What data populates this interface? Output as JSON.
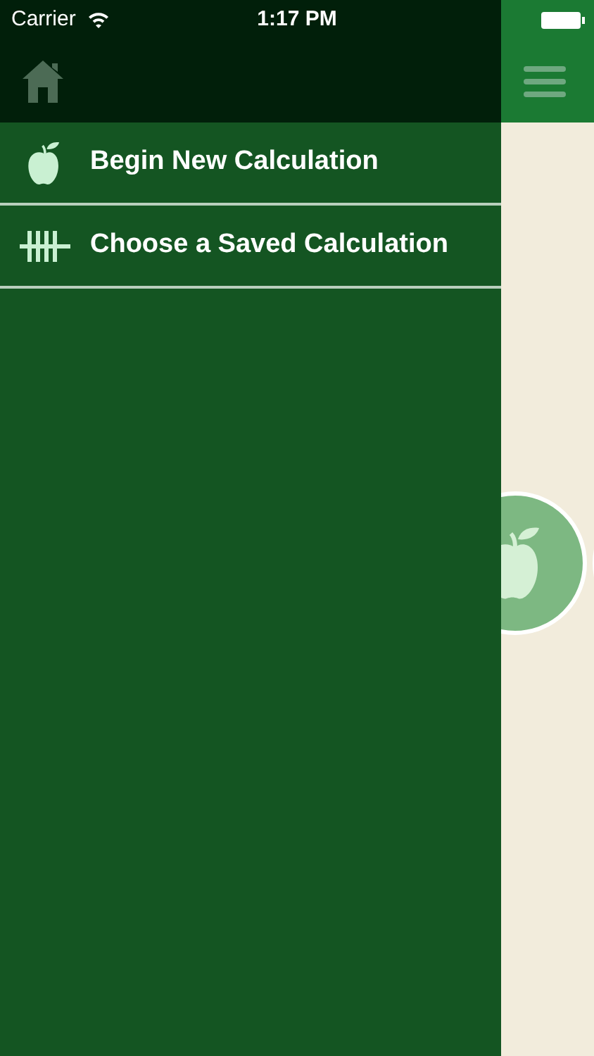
{
  "status_bar": {
    "carrier": "Carrier",
    "time": "1:17 PM"
  },
  "menu_items": [
    {
      "label": "Begin New Calculation",
      "kind": "apple"
    },
    {
      "label": "Choose a Saved Calculation",
      "kind": "tally"
    }
  ]
}
